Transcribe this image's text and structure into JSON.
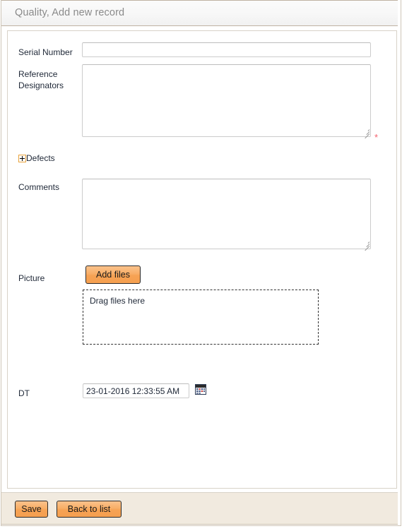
{
  "window": {
    "title": "Quality, Add new record"
  },
  "form": {
    "fields": [
      {
        "label": "Serial Number",
        "type": "text",
        "value": "",
        "placeholder": ""
      },
      {
        "label": "Reference\nDesignators",
        "type": "textarea",
        "value": "",
        "placeholder": "",
        "required_marker": "*"
      },
      {
        "label": "Comments",
        "type": "textarea",
        "value": "",
        "placeholder": ""
      },
      {
        "label": "Picture",
        "type": "fileupload",
        "value": ""
      },
      {
        "label": "DT",
        "type": "datetime",
        "value": "23-01-2016 12:33:55 AM",
        "placeholder": ""
      }
    ],
    "defects": {
      "label": "Defects",
      "expand_icon": "plus-square-icon",
      "expanded": false
    },
    "upload": {
      "add_files_label": "Add files",
      "drag_text": "Drag files here"
    },
    "datetime_picker_icon": "calendar-icon"
  },
  "footer": {
    "save_label": "Save",
    "back_label": "Back to list"
  },
  "colors": {
    "accent_orange": "#f6a254",
    "button_border": "#2b2b2b",
    "required_red": "#f4636e",
    "title_text": "#8a8a8a",
    "footer_bg": "#f1eadf",
    "frame_border": "#cfc6b8",
    "expander_border": "#e8a33d"
  }
}
